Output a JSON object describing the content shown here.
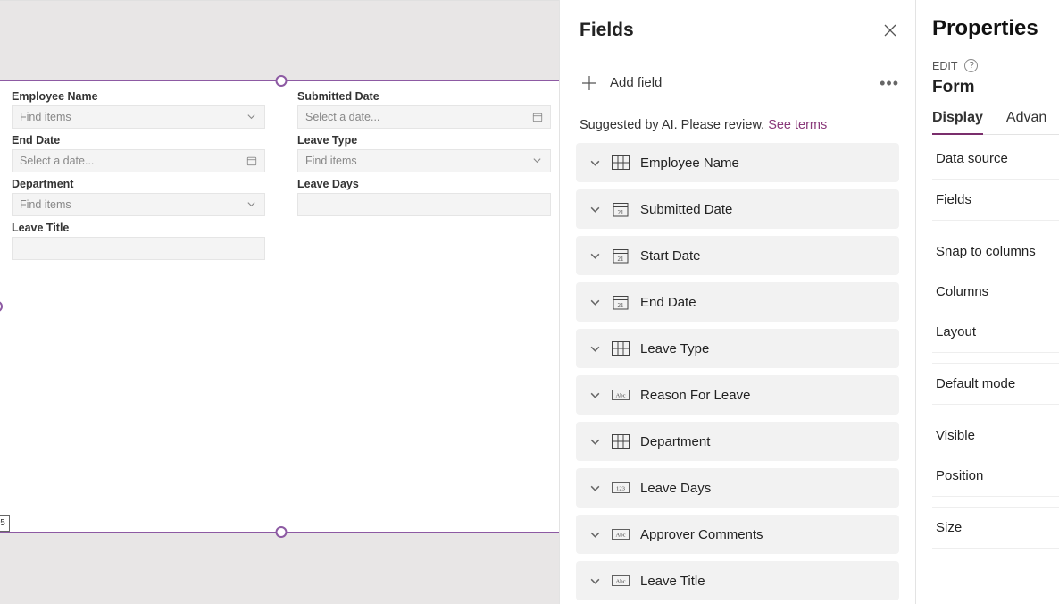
{
  "canvas": {
    "badge": "5",
    "fields": [
      {
        "label": "Employee Name",
        "placeholder": "Find items",
        "control": "lookup"
      },
      {
        "label": "Submitted Date",
        "placeholder": "Select a date...",
        "control": "date"
      },
      {
        "label": "End Date",
        "placeholder": "Select a date...",
        "control": "date"
      },
      {
        "label": "Leave Type",
        "placeholder": "Find items",
        "control": "lookup"
      },
      {
        "label": "Department",
        "placeholder": "Find items",
        "control": "lookup"
      },
      {
        "label": "Leave Days",
        "placeholder": "",
        "control": "text"
      },
      {
        "label": "Leave Title",
        "placeholder": "",
        "control": "text"
      }
    ]
  },
  "fieldsPanel": {
    "title": "Fields",
    "addFieldLabel": "Add field",
    "suggestedPrefix": "Suggested by AI. Please review. ",
    "suggestedLink": "See terms",
    "items": [
      {
        "label": "Employee Name",
        "icon": "grid"
      },
      {
        "label": "Submitted Date",
        "icon": "date"
      },
      {
        "label": "Start Date",
        "icon": "date"
      },
      {
        "label": "End Date",
        "icon": "date"
      },
      {
        "label": "Leave Type",
        "icon": "grid"
      },
      {
        "label": "Reason For Leave",
        "icon": "abc"
      },
      {
        "label": "Department",
        "icon": "grid"
      },
      {
        "label": "Leave Days",
        "icon": "num"
      },
      {
        "label": "Approver Comments",
        "icon": "abc"
      },
      {
        "label": "Leave Title",
        "icon": "abc"
      }
    ]
  },
  "propertiesPanel": {
    "title": "Properties",
    "editLabel": "EDIT",
    "formName": "Form",
    "tabs": [
      {
        "label": "Display",
        "active": true
      },
      {
        "label": "Advan",
        "active": false
      }
    ],
    "rows": [
      "Data source",
      "Fields",
      "Snap to columns",
      "Columns",
      "Layout",
      "Default mode",
      "Visible",
      "Position",
      "Size"
    ]
  }
}
